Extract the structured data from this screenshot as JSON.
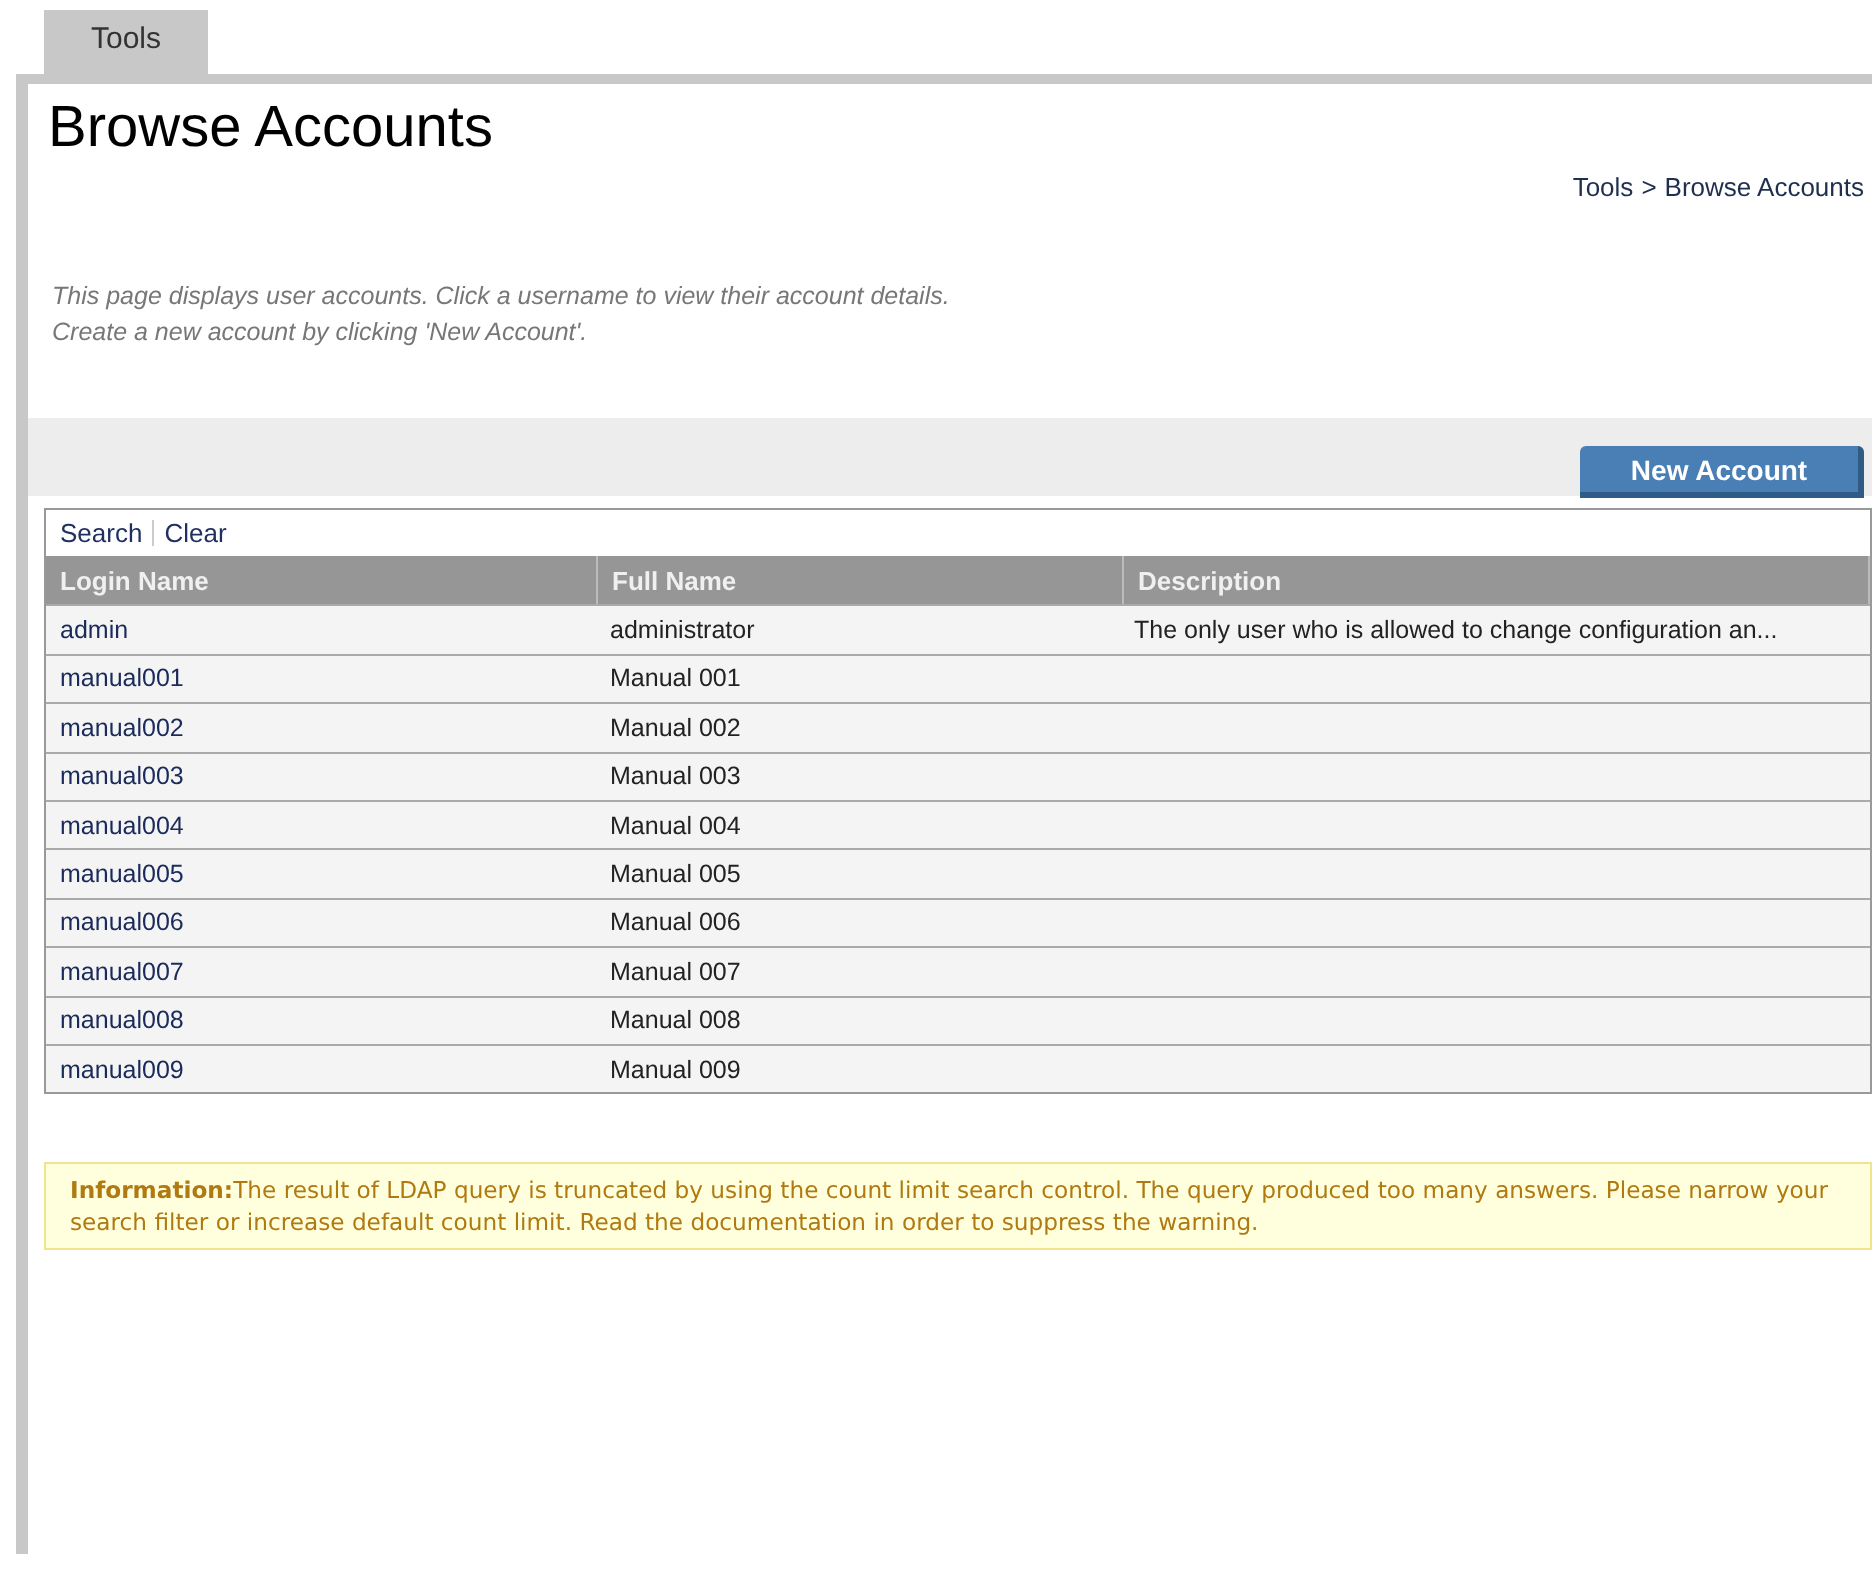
{
  "tabs": [
    {
      "label": "Tools",
      "selected": true
    }
  ],
  "page": {
    "title": "Browse Accounts",
    "breadcrumb": [
      {
        "label": "Tools"
      },
      {
        "label": "Browse Accounts"
      }
    ],
    "breadcrumb_separator": ">",
    "intro": [
      "This page displays user accounts. Click a username to view their account details.",
      "Create a new account by clicking 'New Account'."
    ]
  },
  "toolbar": {
    "button": "New Account"
  },
  "table": {
    "links": [
      "Search",
      "Clear"
    ],
    "columns": [
      "Login Name",
      "Full Name",
      "Description"
    ],
    "rows": [
      [
        "admin",
        "administrator",
        "The only user who is allowed to change configuration an..."
      ],
      [
        "manual001",
        "Manual 001",
        ""
      ],
      [
        "manual002",
        "Manual 002",
        ""
      ],
      [
        "manual003",
        "Manual 003",
        ""
      ],
      [
        "manual004",
        "Manual 004",
        ""
      ],
      [
        "manual005",
        "Manual 005",
        ""
      ],
      [
        "manual006",
        "Manual 006",
        ""
      ],
      [
        "manual007",
        "Manual 007",
        ""
      ],
      [
        "manual008",
        "Manual 008",
        ""
      ],
      [
        "manual009",
        "Manual 009",
        ""
      ]
    ]
  },
  "info": "**Information:**The result of LDAP query is truncated by using the count limit search control. The query produced too many answers. Please narrow your search filter or increase default count limit. Read the documentation in order to suppress the warning."
}
